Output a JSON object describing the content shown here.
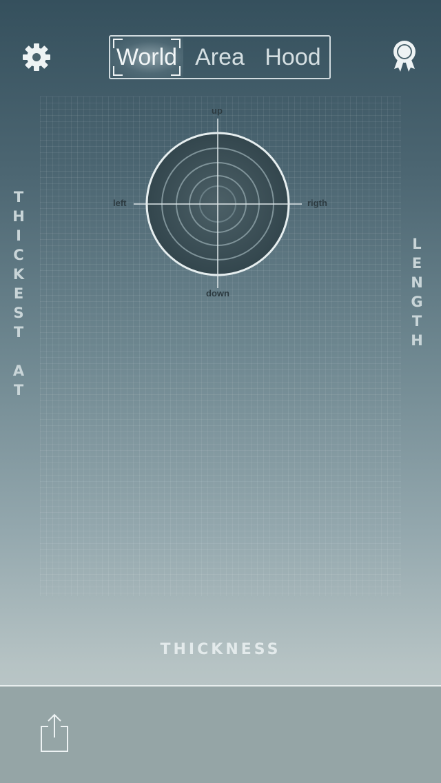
{
  "header": {
    "settings_icon": "gear-icon",
    "award_icon": "award-ribbon-icon",
    "tabs": [
      {
        "label": "World",
        "active": true
      },
      {
        "label": "Area",
        "active": false
      },
      {
        "label": "Hood",
        "active": false
      }
    ]
  },
  "radar": {
    "up": "up",
    "down": "down",
    "left": "left",
    "right": "rigth"
  },
  "axes": {
    "left_vertical": [
      "T",
      "H",
      "I",
      "C",
      "K",
      "E",
      "S",
      "T",
      "",
      "A",
      "T"
    ],
    "right_vertical": [
      "L",
      "E",
      "N",
      "G",
      "T",
      "H"
    ],
    "bottom": "THICKNESS"
  },
  "footer": {
    "share_icon": "share-icon"
  },
  "colors": {
    "accent_text": "#e3eaeb",
    "radar_fill": "#3f5359"
  }
}
